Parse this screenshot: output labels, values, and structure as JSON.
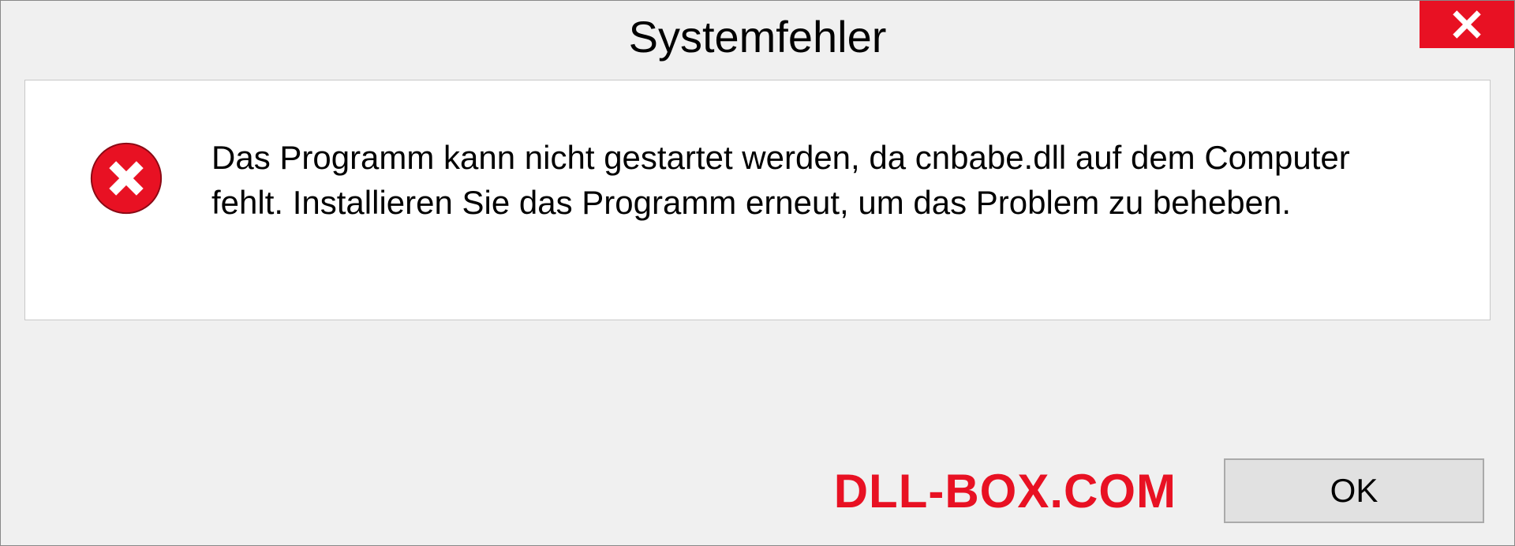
{
  "dialog": {
    "title": "Systemfehler",
    "message": "Das Programm kann nicht gestartet werden, da cnbabe.dll auf dem Computer fehlt. Installieren Sie das Programm erneut, um das Problem zu beheben.",
    "ok_label": "OK"
  },
  "watermark": "DLL-BOX.COM"
}
